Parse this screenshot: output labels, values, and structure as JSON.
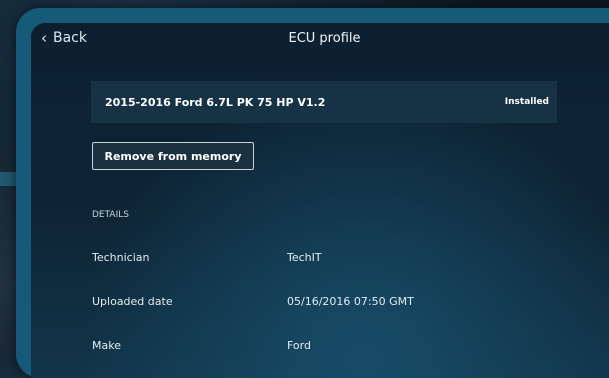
{
  "header": {
    "back_label": "Back",
    "title": "ECU profile"
  },
  "profile": {
    "name": "2015-2016 Ford 6.7L PK 75 HP V1.2",
    "status": "Installed"
  },
  "actions": {
    "remove_label": "Remove from memory"
  },
  "details": {
    "section_label": "DETAILS",
    "rows": [
      {
        "label": "Technician",
        "value": "TechIT"
      },
      {
        "label": "Uploaded date",
        "value": "05/16/2016 07:50 GMT"
      },
      {
        "label": "Make",
        "value": "Ford"
      }
    ]
  },
  "icons": {
    "back": "chevron-left-icon"
  },
  "colors": {
    "device_frame": "#165a79",
    "background": "#0b1722",
    "row_background": "#163244"
  }
}
